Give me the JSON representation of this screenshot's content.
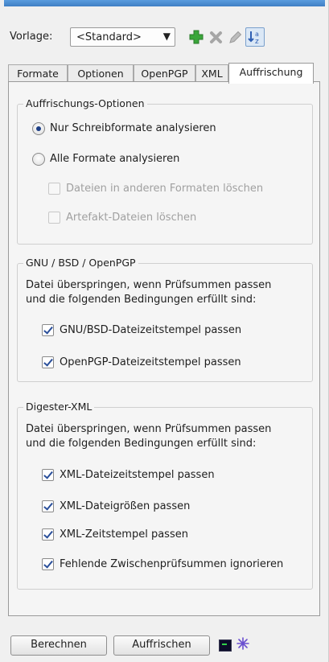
{
  "toolbar": {
    "vorlage_label": "Vorlage:",
    "vorlage_value": "<Standard>"
  },
  "tabs": [
    {
      "label": "Formate"
    },
    {
      "label": "Optionen"
    },
    {
      "label": "OpenPGP"
    },
    {
      "label": "XML"
    },
    {
      "label": "Auffrischung"
    }
  ],
  "groups": {
    "auffrischung": {
      "title": "Auffrischungs-Optionen",
      "radio_1": "Nur Schreibformate analysieren",
      "radio_2": "Alle Formate analysieren",
      "check_1": "Dateien in anderen Formaten löschen",
      "check_2": "Artefakt-Dateien löschen"
    },
    "gnu": {
      "title": "GNU / BSD / OpenPGP",
      "text_line_1": "Datei überspringen, wenn Prüfsummen passen",
      "text_line_2": "und die folgenden Bedingungen erfüllt sind:",
      "check_1": "GNU/BSD-Dateizeitstempel passen",
      "check_2": "OpenPGP-Dateizeitstempel passen"
    },
    "xml": {
      "title": "Digester-XML",
      "text_line_1": "Datei überspringen, wenn Prüfsummen passen",
      "text_line_2": "und die folgenden Bedingungen erfüllt sind:",
      "check_1": "XML-Dateizeitstempel passen",
      "check_2": "XML-Dateigrößen passen",
      "check_3": "XML-Zeitstempel passen",
      "check_4": "Fehlende Zwischenprüfsummen ignorieren"
    }
  },
  "buttons": {
    "berechnen": "Berechnen",
    "auffrischen": "Auffrischen"
  },
  "icons": {
    "add": "plus-icon",
    "delete": "x-icon",
    "edit": "pencil-icon",
    "sort": "sort-icon",
    "terminal": "terminal-icon",
    "extra": "star-icon"
  },
  "colors": {
    "accent": "#3f7fc4",
    "add_green": "#3aa63a",
    "check_mark": "#2a4f9a"
  }
}
